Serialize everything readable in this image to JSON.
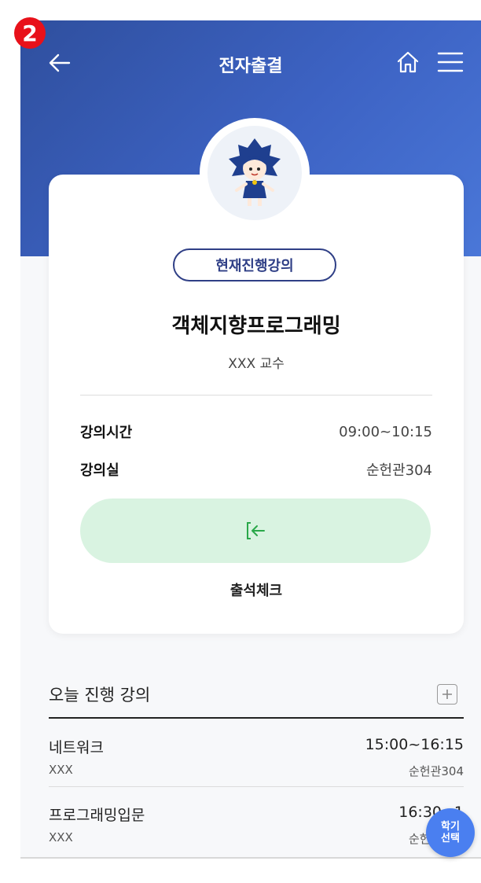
{
  "step_badge": "2",
  "header": {
    "title": "전자출결",
    "icons": {
      "back": "arrow-left-icon",
      "home": "home-icon",
      "menu": "hamburger-menu-icon"
    }
  },
  "current_lecture": {
    "badge": "현재진행강의",
    "course_name": "객체지향프로그래밍",
    "professor": "XXX 교수",
    "time_label": "강의시간",
    "time_value": "09:00~10:15",
    "room_label": "강의실",
    "room_value": "순헌관304",
    "checkin_label": "출석체크",
    "checkin_icon": "sign-in-icon"
  },
  "today": {
    "title": "오늘 진행 강의",
    "add_icon": "plus-box-icon",
    "lectures": [
      {
        "name": "네트워크",
        "time": "15:00~16:15",
        "professor": "XXX",
        "room": "순헌관304"
      },
      {
        "name": "프로그래밍입문",
        "time": "16:30~1",
        "professor": "XXX",
        "room": "순헌관304"
      }
    ]
  },
  "term_button": {
    "line1": "학기",
    "line2": "선택"
  },
  "colors": {
    "header_start": "#2f4f9e",
    "header_end": "#4a77d8",
    "accent": "#2f3f86",
    "checkin_bg": "#d9f3e1",
    "checkin_icon": "#2aa84a",
    "term_button": "#4a7ff0",
    "step_badge": "#e8111a"
  }
}
